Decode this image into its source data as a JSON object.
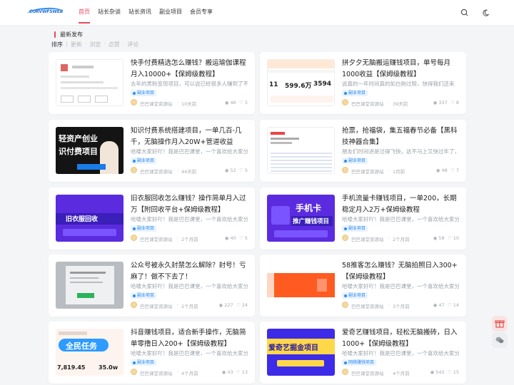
{
  "header": {
    "logo_text": "CORVWFSWEB",
    "nav": [
      {
        "label": "首页",
        "active": true
      },
      {
        "label": "站长杂谈",
        "active": false
      },
      {
        "label": "站长资讯",
        "active": false
      },
      {
        "label": "副业项目",
        "active": false
      },
      {
        "label": "会员专享",
        "active": false
      }
    ]
  },
  "section": {
    "title": "最新发布",
    "sort_label": "排序",
    "sort_options": [
      "更新",
      "浏览",
      "点赞",
      "评论"
    ]
  },
  "thumb_text": {
    "t3a": "轻资产创业",
    "t3b": "识付费项目",
    "t4": "旧衣服回收",
    "t5a": "手机卡",
    "t5b": "推广赚钱项目",
    "t8a": "全民任务",
    "t8b": "7,819.45",
    "t8c": "35.0w",
    "t9": "爱奇艺掘金项目",
    "t2a": "599.6万",
    "t2b": "3594",
    "t2c": "11"
  },
  "posts": [
    {
      "title": "快手付费精选怎么赚钱？搬运瑜伽课程月入10000+【保姆级教程】",
      "excerpt": "去年的男粉变现项目，可以说已经很多人赚到了不",
      "tag": "副业项目",
      "author": "巴巴课堂资源站",
      "time": "10天前",
      "views": "46",
      "likes": "5"
    },
    {
      "title": "拼夕夕无脑搬运赚钱项目，单号每月1000收益【保姆级教程】",
      "excerpt": "说真的一年时间真的如白驹过隙，快得我们还来",
      "tag": "副业项目",
      "author": "巴巴课堂资源站",
      "time": "39天前",
      "views": "337",
      "likes": "8"
    },
    {
      "title": "知识付费系统搭建项目，一单几百-几千，无脑操作月入20W+管道收益",
      "excerpt": "哈喽大家好吖！我是巴巴课堂，一个喜欢给大家分",
      "tag": "副业项目",
      "author": "巴巴课堂资源站",
      "time": "44天前",
      "views": "52",
      "likes": "5"
    },
    {
      "title": "抢票，抢福袋，集五福春节必备【黑科技神器合集】",
      "excerpt": "朋友们时间进是过得飞快，这不马上又快过年了，",
      "tag": "副业项目",
      "author": "巴巴课堂资源站",
      "time": "1月前",
      "views": "48",
      "likes": "7"
    },
    {
      "title": "旧衣服回收怎么赚钱？操作简单月入过万【附回收平台+保姆级教程】",
      "excerpt": "哈喽大家好吖！我是巴巴课堂，一个喜欢给大家分",
      "tag": "副业项目",
      "author": "巴巴课堂资源站",
      "time": "2个月前",
      "views": "40",
      "likes": "5"
    },
    {
      "title": "手机流量卡赚钱项目，一单200，长期稳定月入2万+保姆级教程",
      "excerpt": "哈喽大家好吖！我是巴巴课堂，一个喜欢给大家分",
      "tag": "副业项目",
      "author": "巴巴课堂资源站",
      "time": "2个月前",
      "views": "58",
      "likes": "10"
    },
    {
      "title": "公众号被永久封禁怎么解除？封号！亏麻了！做不下去了！",
      "excerpt": "哈喽大家好吖！我是巴巴课堂，一个喜欢给大家分",
      "tag": "副业项目",
      "author": "巴巴课堂资源站",
      "time": "2个月前",
      "views": "227",
      "likes": "24"
    },
    {
      "title": "58推客怎么赚钱？无脑拍照日入300+【保姆级教程】",
      "excerpt": "哈喽大家好吖！我是巴巴课堂，一个喜欢给大家分",
      "tag": "副业项目",
      "author": "巴巴课堂资源站",
      "time": "3个月前",
      "views": "47",
      "likes": "14"
    },
    {
      "title": "抖音赚钱项目，适合新手操作，无脑简单零撸日入200+【保姆级教程】",
      "excerpt": "哈喽大家好吖！我是巴巴课堂，一个喜欢给大家分",
      "tag": "副业项目",
      "author": "巴巴课堂资源站",
      "time": "4个月前",
      "views": "43",
      "likes": "13"
    },
    {
      "title": "爱奇艺赚钱项目，轻松无脑搬砖，日入1000+【保姆级教程】",
      "excerpt": "哈喽大家好吖！我是巴巴课堂，一个喜欢给大家分",
      "tag": "网络赚钱项目",
      "author": "巴巴课堂资源站",
      "time": "4个月前",
      "views": "542",
      "likes": "15"
    }
  ]
}
